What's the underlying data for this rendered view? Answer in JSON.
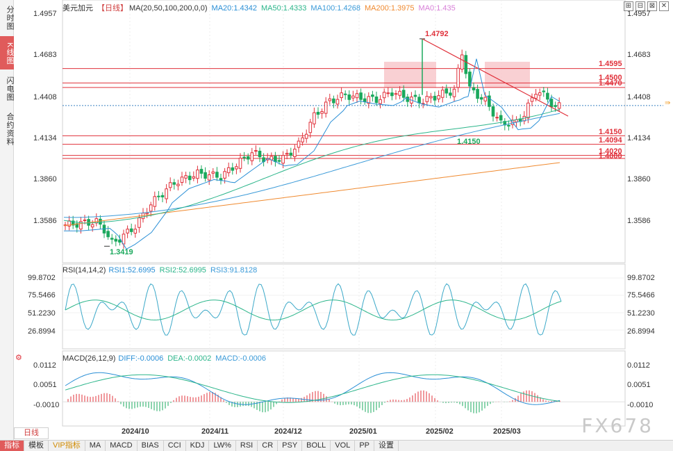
{
  "left_tabs": [
    {
      "label": "分时图",
      "active": false
    },
    {
      "label": "K线图",
      "active": true
    },
    {
      "label": "闪电图",
      "active": false
    },
    {
      "label": "合约资料",
      "active": false
    }
  ],
  "header": {
    "symbol": "美元加元",
    "period_tag": "【日线】",
    "ma_label": "MA(20,50,100,200,0,0)",
    "ma20": "MA20:1.4342",
    "ma50": "MA50:1.4333",
    "ma100": "MA100:1.4268",
    "ma200": "MA200:1.3975",
    "ma0": "MA0:1.435"
  },
  "window_controls": [
    "⊞",
    "⊟",
    "⊠",
    "✕"
  ],
  "price_axis": [
    "1.4957",
    "1.4683",
    "1.4408",
    "1.4134",
    "1.3860",
    "1.3586"
  ],
  "annotations": {
    "high": "1.4792",
    "low": "1.3419",
    "low2": "1.4150",
    "levels": [
      "1.4595",
      "1.4500",
      "1.4470",
      "1.4150",
      "1.4094",
      "1.4020",
      "1.4000"
    ]
  },
  "rsi": {
    "label": "RSI(14,14,2)",
    "rsi1": "RSI1:52.6995",
    "rsi2": "RSI2:52.6995",
    "rsi3": "RSI3:91.8128",
    "axis": [
      "99.8702",
      "75.5466",
      "51.2230",
      "26.8994"
    ]
  },
  "macd": {
    "label": "MACD(26,12,9)",
    "diff": "DIFF:-0.0006",
    "dea": "DEA:-0.0002",
    "macd": "MACD:-0.0006",
    "axis": [
      "0.0112",
      "0.0051",
      "-0.0010"
    ]
  },
  "dates": [
    "2024/10",
    "2024/11",
    "2024/12",
    "2025/01",
    "2025/02",
    "2025/03"
  ],
  "period_tab": "日线",
  "bottom_bar": [
    "指标",
    "模板",
    "VIP指标",
    "MA",
    "MACD",
    "BIAS",
    "CCI",
    "KDJ",
    "LW%",
    "RSI",
    "CR",
    "PSY",
    "BOLL",
    "VOL",
    "PP",
    "设置"
  ],
  "watermark": "FX678",
  "colors": {
    "up": "#e0303a",
    "down": "#1aa85c",
    "ma20": "#2a8fd6",
    "ma50": "#2bb58a",
    "ma100": "#3a9ad8",
    "ma200": "#f08a30",
    "resistance": "#e0303a",
    "zone": "#f7c4c8"
  },
  "chart_data": {
    "type": "candlestick",
    "title": "美元加元 日线",
    "ylim": [
      1.335,
      1.5
    ],
    "x_tick_labels": [
      "2024/10",
      "2024/11",
      "2024/12",
      "2025/01",
      "2025/02",
      "2025/03"
    ],
    "horizontal_levels": [
      1.4595,
      1.45,
      1.447,
      1.415,
      1.4094,
      1.402,
      1.4
    ],
    "high_label": 1.4792,
    "low_label": 1.3419,
    "last_close": 1.435
  }
}
